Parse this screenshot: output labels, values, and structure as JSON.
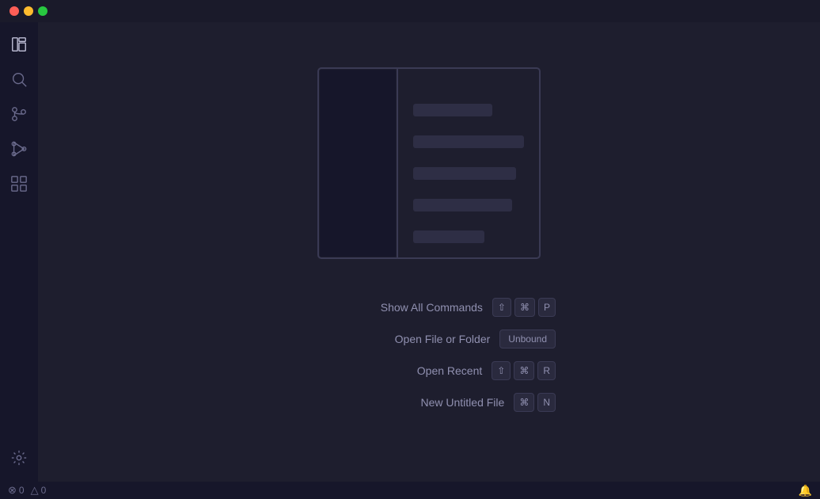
{
  "titleBar": {
    "trafficLights": [
      "close",
      "minimize",
      "maximize"
    ]
  },
  "sidebar": {
    "items": [
      {
        "id": "files",
        "label": "Files",
        "icon": "files-icon",
        "active": true
      },
      {
        "id": "search",
        "label": "Search",
        "icon": "search-icon",
        "active": false
      },
      {
        "id": "git",
        "label": "Source Control",
        "icon": "git-icon",
        "active": false
      },
      {
        "id": "debug",
        "label": "Run and Debug",
        "icon": "debug-icon",
        "active": false
      },
      {
        "id": "extensions",
        "label": "Extensions",
        "icon": "extensions-icon",
        "active": false
      }
    ],
    "bottomItems": [
      {
        "id": "settings",
        "label": "Settings",
        "icon": "settings-icon"
      }
    ]
  },
  "shortcuts": [
    {
      "id": "show-all-commands",
      "label": "Show All Commands",
      "keys": [
        "⇧",
        "⌘",
        "P"
      ]
    },
    {
      "id": "open-file-or-folder",
      "label": "Open File or Folder",
      "keys": [
        "Unbound"
      ]
    },
    {
      "id": "open-recent",
      "label": "Open Recent",
      "keys": [
        "⇧",
        "⌘",
        "R"
      ]
    },
    {
      "id": "new-untitled-file",
      "label": "New Untitled File",
      "keys": [
        "⌘",
        "N"
      ]
    }
  ],
  "statusBar": {
    "leftItems": [
      {
        "icon": "error-icon",
        "count": "0"
      },
      {
        "icon": "warning-icon",
        "count": "0"
      }
    ],
    "bellIcon": "bell-icon"
  }
}
